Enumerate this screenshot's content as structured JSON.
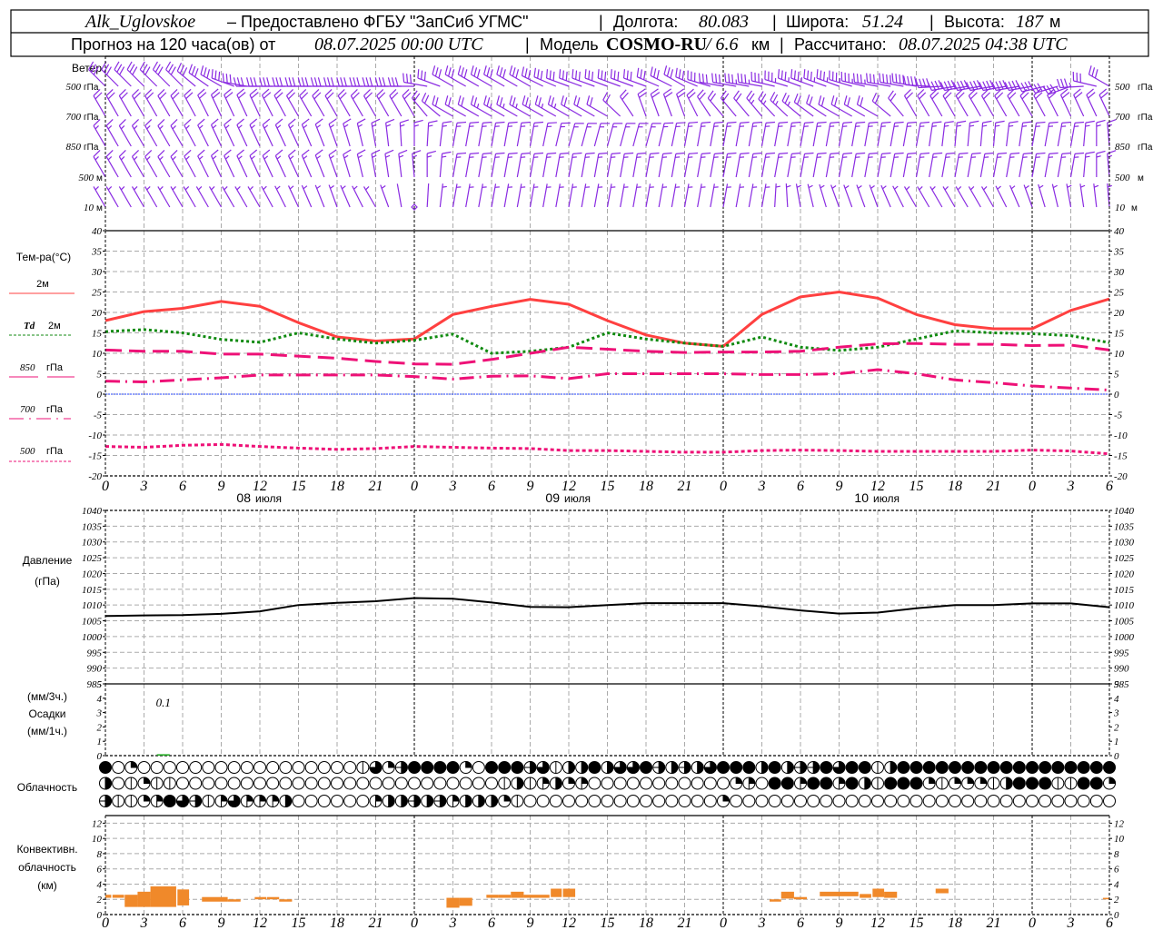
{
  "header": {
    "station": "Alk_Uglovskoe",
    "provider": "– Предоставлено ФГБУ \"ЗапСиб УГМС\"",
    "lon_label": "Долгота:",
    "lon": "80.083",
    "lat_label": "Широта:",
    "lat": "51.24",
    "alt_label": "Высота:",
    "alt": "187",
    "alt_unit": "м",
    "forecast_prefix": "Прогноз на 120 часа(ов) от",
    "forecast_time": "08.07.2025 00:00 UTC",
    "model_label": "Модель",
    "model": "COSMO-RU",
    "model_res": "/ 6.6",
    "model_res_unit": "км",
    "calc_label": "Рассчитано:",
    "calc_time": "08.07.2025 04:38 UTC",
    "separator": "|"
  },
  "x_axis": {
    "hours": [
      0,
      3,
      6,
      9,
      12,
      15,
      18,
      21,
      24,
      27,
      30,
      33,
      36,
      39,
      42,
      45,
      48,
      51,
      54,
      57,
      60,
      63,
      66,
      69,
      72,
      75,
      78
    ],
    "tick_labels": [
      "0",
      "3",
      "6",
      "9",
      "12",
      "15",
      "18",
      "21",
      "0",
      "3",
      "6",
      "9",
      "12",
      "15",
      "18",
      "21",
      "0",
      "3",
      "6",
      "9",
      "12",
      "15",
      "18",
      "21",
      "0",
      "3",
      "6"
    ],
    "day_labels": [
      {
        "day": "08",
        "month": "июля"
      },
      {
        "day": "09",
        "month": "июля"
      },
      {
        "day": "10",
        "month": "июля"
      }
    ]
  },
  "colors": {
    "wind": "#8a2be2",
    "t2m": "#ff4040",
    "td2m": "#108a10",
    "upper": "#ee1177",
    "zero": "#2040ff",
    "pressure": "#000000",
    "precip": "#22aa22",
    "convective": "#f0892a"
  },
  "chart_data": [
    {
      "id": "wind",
      "type": "barbs",
      "title": "Ветер",
      "levels": [
        {
          "label_num": "500",
          "label_unit": "гПа",
          "dir": [
            315,
            315,
            315,
            300,
            270,
            270,
            270,
            270,
            270,
            300,
            300,
            300,
            290,
            290,
            290,
            300,
            280,
            280,
            290,
            290,
            280,
            280,
            260,
            260,
            260,
            250,
            300
          ],
          "speed": [
            15,
            15,
            15,
            15,
            15,
            15,
            15,
            15,
            15,
            15,
            15,
            15,
            15,
            15,
            15,
            15,
            15,
            18,
            18,
            18,
            18,
            20,
            20,
            20,
            20,
            18,
            15
          ]
        },
        {
          "label_num": "700",
          "label_unit": "гПа",
          "dir": [
            330,
            330,
            330,
            335,
            335,
            330,
            330,
            330,
            330,
            300,
            300,
            300,
            300,
            300,
            340,
            340,
            320,
            320,
            310,
            300,
            300,
            330,
            330,
            330,
            330,
            335,
            335
          ],
          "speed": [
            10,
            10,
            10,
            10,
            10,
            10,
            10,
            10,
            10,
            10,
            12,
            12,
            12,
            10,
            10,
            10,
            10,
            12,
            12,
            10,
            10,
            10,
            10,
            10,
            10,
            10,
            10
          ]
        },
        {
          "label_num": "850",
          "label_unit": "гПа",
          "dir": [
            330,
            330,
            330,
            335,
            335,
            335,
            340,
            350,
            360,
            10,
            10,
            10,
            15,
            15,
            15,
            10,
            10,
            10,
            10,
            10,
            10,
            10,
            5,
            5,
            10,
            10,
            355
          ],
          "speed": [
            8,
            8,
            8,
            8,
            8,
            8,
            8,
            8,
            8,
            8,
            9,
            9,
            9,
            9,
            9,
            9,
            9,
            9,
            9,
            9,
            9,
            8,
            8,
            8,
            8,
            8,
            7
          ]
        },
        {
          "label_num": "500",
          "label_unit": "м",
          "dir": [
            330,
            330,
            330,
            335,
            335,
            335,
            340,
            350,
            355,
            10,
            10,
            10,
            10,
            10,
            10,
            10,
            10,
            10,
            10,
            10,
            10,
            10,
            10,
            10,
            10,
            10,
            355
          ],
          "speed": [
            7,
            8,
            8,
            8,
            8,
            8,
            8,
            8,
            7,
            8,
            8,
            8,
            8,
            8,
            8,
            8,
            8,
            8,
            8,
            8,
            8,
            8,
            8,
            8,
            8,
            7,
            7
          ]
        },
        {
          "label_num": "10",
          "label_unit": "м",
          "dir": [
            330,
            330,
            330,
            330,
            330,
            335,
            340,
            330,
            0,
            10,
            10,
            10,
            10,
            10,
            10,
            10,
            10,
            10,
            350,
            340,
            340,
            330,
            330,
            330,
            340,
            350,
            355
          ],
          "speed": [
            4,
            4,
            4,
            4,
            4,
            3,
            3,
            3,
            0,
            3,
            4,
            4,
            4,
            4,
            4,
            4,
            3,
            3,
            3,
            3,
            3,
            3,
            3,
            3,
            3,
            3,
            3
          ]
        }
      ]
    },
    {
      "id": "temperature",
      "type": "line",
      "ylabel": "Тем-ра(°С)",
      "ylim": [
        -20,
        40
      ],
      "yticks": [
        "40",
        "35",
        "30",
        "25",
        "20",
        "15",
        "10",
        "5",
        "0",
        "-5",
        "-10",
        "-15",
        "-20"
      ],
      "grid": true,
      "series": [
        {
          "name": "2м",
          "values": [
            18,
            20.2,
            21,
            22.7,
            21.5,
            17.5,
            14,
            13,
            13.5,
            19.5,
            21.5,
            23.2,
            22,
            18,
            14.5,
            12.5,
            11.7,
            19.5,
            23.8,
            25,
            23.5,
            19.5,
            17,
            16,
            16,
            20.5,
            23.3
          ]
        },
        {
          "name_italic": "Td",
          "name": "2м",
          "values": [
            15.3,
            15.8,
            15,
            13.4,
            12.7,
            15,
            13.5,
            12.5,
            13.2,
            14.7,
            10,
            10.5,
            11.5,
            15,
            13.5,
            12.5,
            11.7,
            14,
            11.5,
            10.7,
            11.5,
            13.5,
            15.5,
            15,
            14.8,
            14.3,
            12.6
          ]
        },
        {
          "name_num": "850",
          "name": "гПа",
          "values": [
            10.8,
            10.5,
            10.5,
            9.8,
            9.8,
            9.3,
            8.8,
            8,
            7.4,
            7.3,
            8.5,
            10,
            11.5,
            11,
            10.5,
            10.2,
            10.3,
            10.3,
            10.5,
            11.5,
            12.3,
            12.4,
            12.2,
            12.2,
            11.9,
            12,
            10.8
          ]
        },
        {
          "name_num": "700",
          "name": "гПа",
          "values": [
            3.2,
            3,
            3.5,
            4,
            4.7,
            4.7,
            4.7,
            4.7,
            4.3,
            3.7,
            4.4,
            4.5,
            3.8,
            5,
            5,
            5,
            5,
            4.8,
            4.8,
            5,
            6,
            5,
            3.5,
            2.8,
            2,
            1.5,
            1
          ]
        },
        {
          "name_num": "500",
          "name": "гПа",
          "values": [
            -12.8,
            -13,
            -12.5,
            -12.3,
            -12.8,
            -13.2,
            -13.5,
            -13.3,
            -12.8,
            -13,
            -13.2,
            -13.3,
            -13.8,
            -13.8,
            -14,
            -14.2,
            -14.2,
            -13.8,
            -13.7,
            -13.8,
            -14,
            -14,
            -14,
            -14,
            -13.7,
            -13.9,
            -14.6
          ]
        }
      ]
    },
    {
      "id": "pressure",
      "type": "line",
      "ylabel": "Давление",
      "yunit": "(гПа)",
      "ylim": [
        985,
        1040
      ],
      "yticks": [
        "1040",
        "1035",
        "1030",
        "1025",
        "1020",
        "1015",
        "1010",
        "1005",
        "1000",
        "995",
        "990",
        "985"
      ],
      "grid": true,
      "values": [
        1006.5,
        1006.7,
        1006.8,
        1007.2,
        1008,
        1010,
        1010.7,
        1011.2,
        1012.2,
        1012,
        1010.8,
        1009.4,
        1009.3,
        1010,
        1010.6,
        1010.6,
        1010.6,
        1009.6,
        1008.3,
        1007.3,
        1007.6,
        1009,
        1010,
        1010,
        1010.5,
        1010.5,
        1009.3
      ]
    },
    {
      "id": "precipitation",
      "type": "bar",
      "ylabel": "Осадки",
      "unit_3h": "(мм/3ч.)",
      "unit_1h": "(мм/1ч.)",
      "ylim": [
        0,
        5
      ],
      "yticks": [
        "5",
        "4",
        "3",
        "2",
        "1",
        "0"
      ],
      "bars": [
        {
          "start": 4,
          "end": 5,
          "value": 0.1
        }
      ],
      "annotations": [
        {
          "hour": 4.5,
          "text": "0.1"
        }
      ]
    },
    {
      "id": "cloudiness",
      "type": "table",
      "label": "Облачность",
      "scale": "oktas 0-8, hourly",
      "rows": [
        [
          8,
          0,
          2,
          0,
          0,
          0,
          0,
          0,
          0,
          0,
          0,
          0,
          0,
          0,
          0,
          0,
          0,
          0,
          0,
          0,
          1,
          6,
          2,
          5,
          8,
          8,
          8,
          8,
          2,
          0,
          8,
          8,
          8,
          5,
          6,
          1,
          4,
          4,
          8,
          4,
          6,
          6,
          8,
          5,
          4,
          5,
          4,
          6,
          8,
          8,
          8,
          4,
          8,
          4,
          5,
          5,
          8,
          6,
          8,
          8,
          1,
          4,
          8,
          8,
          8,
          8,
          8,
          8,
          8,
          8,
          8,
          8,
          8,
          8,
          8,
          8,
          8,
          8,
          8
        ],
        [
          4,
          0,
          1,
          2,
          1,
          1,
          0,
          0,
          0,
          0,
          0,
          0,
          0,
          0,
          0,
          0,
          0,
          0,
          0,
          0,
          0,
          0,
          0,
          0,
          0,
          0,
          0,
          0,
          0,
          0,
          0,
          1,
          4,
          1,
          3,
          4,
          2,
          3,
          0,
          0,
          0,
          0,
          0,
          0,
          0,
          0,
          0,
          0,
          0,
          2,
          3,
          0,
          8,
          8,
          3,
          8,
          8,
          3,
          8,
          4,
          1,
          8,
          8,
          8,
          2,
          1,
          2,
          2,
          2,
          1,
          4,
          8,
          8,
          8,
          1,
          1,
          8,
          8,
          2
        ],
        [
          5,
          1,
          1,
          2,
          3,
          8,
          6,
          5,
          1,
          3,
          6,
          3,
          3,
          3,
          4,
          0,
          0,
          0,
          0,
          0,
          0,
          3,
          4,
          4,
          5,
          4,
          5,
          3,
          4,
          4,
          4,
          2,
          1,
          0,
          0,
          0,
          0,
          0,
          0,
          0,
          0,
          0,
          0,
          0,
          0,
          0,
          0,
          0,
          2,
          0,
          0,
          0,
          0,
          0,
          0,
          0,
          0,
          0,
          0,
          0,
          0,
          0,
          0,
          0,
          0,
          0,
          0,
          0,
          0,
          0,
          0,
          0,
          0,
          0,
          0,
          0,
          0,
          0,
          0
        ]
      ]
    },
    {
      "id": "convective",
      "type": "bar",
      "ylabel_1": "Конвективн.",
      "ylabel_2": "облачность",
      "yunit": "(км)",
      "ylim": [
        0,
        13
      ],
      "yticks": [
        "12",
        "10",
        "8",
        "6",
        "4",
        "2",
        "0"
      ],
      "grid": true,
      "bars": [
        {
          "start": 0,
          "end": 0.45,
          "base": 2.2,
          "top": 2.6
        },
        {
          "start": 0.55,
          "end": 1.45,
          "base": 2.2,
          "top": 2.6
        },
        {
          "start": 1.5,
          "end": 2.5,
          "base": 1.0,
          "top": 2.6
        },
        {
          "start": 2.5,
          "end": 3.5,
          "base": 1.0,
          "top": 3.0
        },
        {
          "start": 3.5,
          "end": 5.5,
          "base": 1.0,
          "top": 3.7
        },
        {
          "start": 5.6,
          "end": 6.5,
          "base": 1.2,
          "top": 3.3
        },
        {
          "start": 7.5,
          "end": 9.5,
          "base": 1.7,
          "top": 2.3
        },
        {
          "start": 9.5,
          "end": 10.5,
          "base": 1.7,
          "top": 2.0
        },
        {
          "start": 11.6,
          "end": 12.5,
          "base": 2.0,
          "top": 2.3
        },
        {
          "start": 12.55,
          "end": 13.5,
          "base": 2.0,
          "top": 2.3
        },
        {
          "start": 13.5,
          "end": 14.5,
          "base": 1.7,
          "top": 2.0
        },
        {
          "start": 26.5,
          "end": 27.5,
          "base": 0.9,
          "top": 2.2
        },
        {
          "start": 27.5,
          "end": 28.5,
          "base": 1.15,
          "top": 2.2
        },
        {
          "start": 29.6,
          "end": 30.5,
          "base": 2.2,
          "top": 2.6
        },
        {
          "start": 30.5,
          "end": 31.5,
          "base": 2.2,
          "top": 2.6
        },
        {
          "start": 31.5,
          "end": 32.5,
          "base": 2.2,
          "top": 3.0
        },
        {
          "start": 32.5,
          "end": 34.5,
          "base": 2.2,
          "top": 2.6
        },
        {
          "start": 34.6,
          "end": 35.45,
          "base": 2.3,
          "top": 3.4
        },
        {
          "start": 35.55,
          "end": 36.5,
          "base": 2.3,
          "top": 3.4
        },
        {
          "start": 51.6,
          "end": 52.5,
          "base": 1.7,
          "top": 2.0
        },
        {
          "start": 52.5,
          "end": 53.5,
          "base": 2.1,
          "top": 3.0
        },
        {
          "start": 53.5,
          "end": 54.5,
          "base": 2.0,
          "top": 2.3
        },
        {
          "start": 55.5,
          "end": 58.5,
          "base": 2.4,
          "top": 3.0
        },
        {
          "start": 58.6,
          "end": 59.5,
          "base": 2.2,
          "top": 2.7
        },
        {
          "start": 59.6,
          "end": 60.5,
          "base": 2.3,
          "top": 3.4
        },
        {
          "start": 60.5,
          "end": 61.5,
          "base": 2.2,
          "top": 3.0
        },
        {
          "start": 64.5,
          "end": 65.5,
          "base": 2.8,
          "top": 3.4
        },
        {
          "start": 77.5,
          "end": 78,
          "base": 2.0,
          "top": 2.2
        }
      ]
    }
  ]
}
